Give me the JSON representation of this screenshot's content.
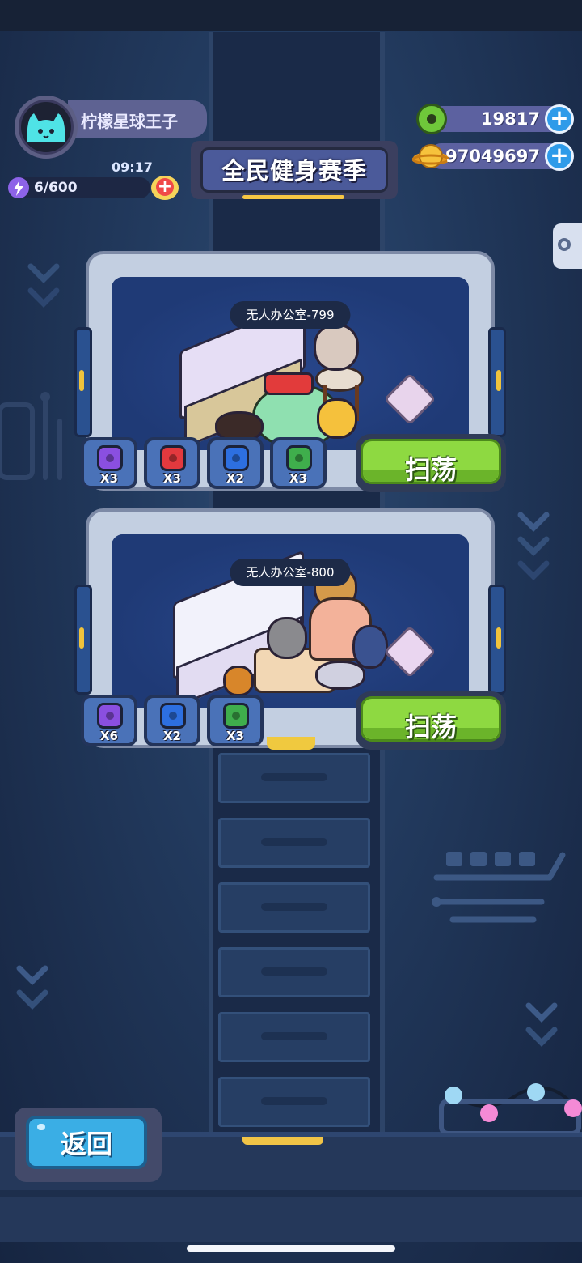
{
  "player": {
    "name": "柠檬星球王子",
    "energy": "6/600",
    "timer": "09:17"
  },
  "season": {
    "title": "全民健身赛季"
  },
  "currencies": [
    {
      "name": "donut",
      "value": "19817"
    },
    {
      "name": "coin-planet",
      "value": "97049697"
    }
  ],
  "levels": [
    {
      "label": "无人办公室-799",
      "rewards": [
        {
          "gem": "purple",
          "qty": "X3",
          "color": "#8a4fe0"
        },
        {
          "gem": "red",
          "qty": "X3",
          "color": "#e2393e"
        },
        {
          "gem": "blue",
          "qty": "X2",
          "color": "#2d6fe0"
        },
        {
          "gem": "green",
          "qty": "X3",
          "color": "#3fae4c"
        }
      ],
      "sweep_label": "扫荡"
    },
    {
      "label": "无人办公室-800",
      "rewards": [
        {
          "gem": "purple",
          "qty": "X6",
          "color": "#8a4fe0"
        },
        {
          "gem": "blue",
          "qty": "X2",
          "color": "#2d6fe0"
        },
        {
          "gem": "green",
          "qty": "X3",
          "color": "#3fae4c"
        }
      ],
      "sweep_label": "扫荡"
    }
  ],
  "back_label": "返回",
  "colors": {
    "accent_green": "#8ed941",
    "accent_blue": "#3aaee5",
    "plus_blue": "#2e9be9"
  }
}
